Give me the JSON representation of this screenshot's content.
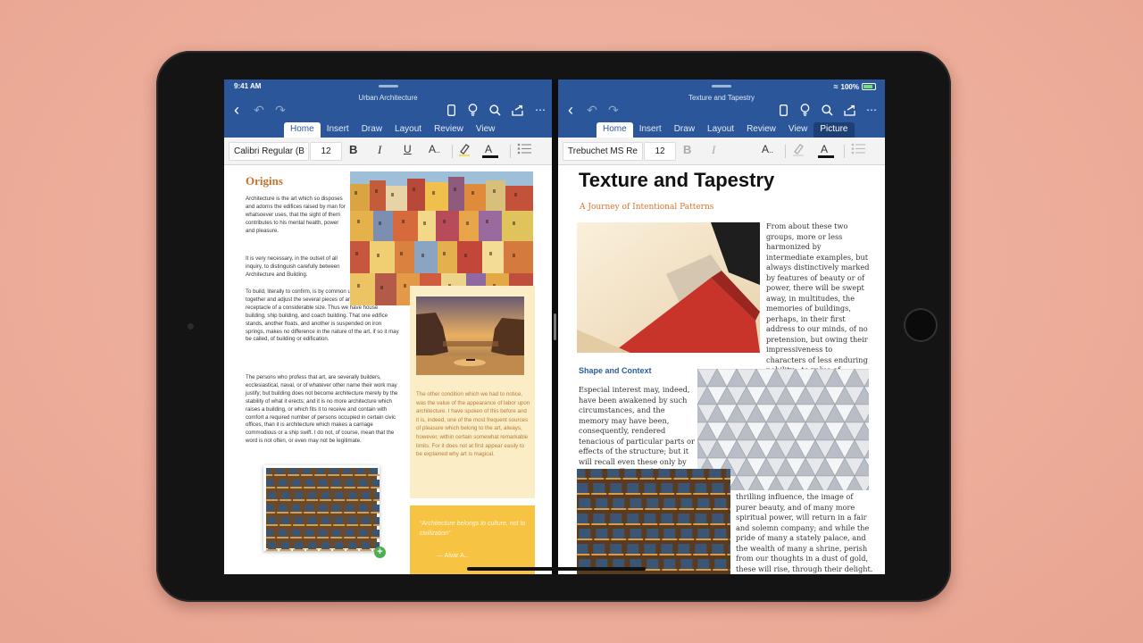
{
  "status": {
    "time": "9:41 AM",
    "battery": "100%"
  },
  "left": {
    "doc_title": "Urban Architecture",
    "tabs": [
      {
        "label": "Home",
        "active": true
      },
      {
        "label": "Insert"
      },
      {
        "label": "Draw"
      },
      {
        "label": "Layout"
      },
      {
        "label": "Review"
      },
      {
        "label": "View"
      }
    ],
    "ribbon": {
      "font": "Calibri Regular (B",
      "size": "12",
      "bold": "B",
      "italic": "I",
      "underline": "U",
      "text_effects": "A",
      "font_color": "A"
    },
    "heading": "Origins",
    "p1": "Architecture is the art which so disposes and adorns the edifices raised by man for whatsoever uses, that the sight of them contributes to his mental health, power and pleasure.",
    "p2": "It is very necessary, in the outset of all inquiry, to distinguish carefully between Architecture and Building.",
    "p3": "To build, literally to confirm, is by common understanding to put together and adjust the several pieces of any edifice or receptacle of a considerable size. Thus we have house building, ship building, and coach building. That one edifice stands, another floats, and another is suspended on iron springs, makes no difference in the nature of the art, if so it may be called, of building or edification.",
    "p4": "The persons who profess that art, are severally builders, ecclesiastical, naval, or of whatever other name their work may justify; but building does not become architecture merely by the stability of what it erects; and it is no more architecture which raises a building, or which fits it to receive and contain with comfort a required number of persons occupied in certain civic offices, than it is architecture which makes a carriage commodious or a ship swift. I do not, of course, mean that the word is not often, or even may not be legitimate.",
    "caption": "The other condition which we had to notice, was the value of the appearance of labor upon architecture. I have spoken of this before and it is, indeed, one of the most frequent sources of pleasure which belong to the art, always, however, within certain somewhat remarkable limits. For it does not at first appear easily to be explained why art is magical.",
    "quote": "“Architecture belongs to culture, not to civilization”",
    "quote_author": "— Alvar A..."
  },
  "right": {
    "doc_title": "Texture and Tapestry",
    "tabs": [
      {
        "label": "Home",
        "active": true
      },
      {
        "label": "Insert"
      },
      {
        "label": "Draw"
      },
      {
        "label": "Layout"
      },
      {
        "label": "Review"
      },
      {
        "label": "View"
      },
      {
        "label": "Picture",
        "context": true
      }
    ],
    "ribbon": {
      "font": "Trebuchet MS Re",
      "size": "12",
      "bold": "B",
      "italic": "I",
      "text_effects": "A",
      "font_color": "A"
    },
    "title": "Texture and Tapestry",
    "subtitle": "A Journey of Intentional Patterns",
    "p1": "From about these two groups, more or less harmonized by intermediate examples, but always distinctively marked by features of beauty or of power, there will be swept away, in multitudes, the memories of buildings, perhaps, in their first address to our minds, of no pretension, but owing their impressiveness to characters of less enduring nobility—to value of material, accumulation of ornament, or ingenuity of mechanical construction.",
    "section_heading": "Shape and Context",
    "p2": "Especial interest may, indeed, have been awakened by such circumstances, and the memory may have been, consequently, rendered tenacious of particular parts or effects of the structure; but it will recall even these only by an active effort, and then without emotion; while in passive moments, and with",
    "p3": "thrilling influence, the image of purer beauty, and of many more spiritual power, will return in a fair and solemn company; and while the pride of many a stately palace, and the wealth of many a shrine, perish from our thoughts in a dust of gold, these will rise, through their delight."
  }
}
